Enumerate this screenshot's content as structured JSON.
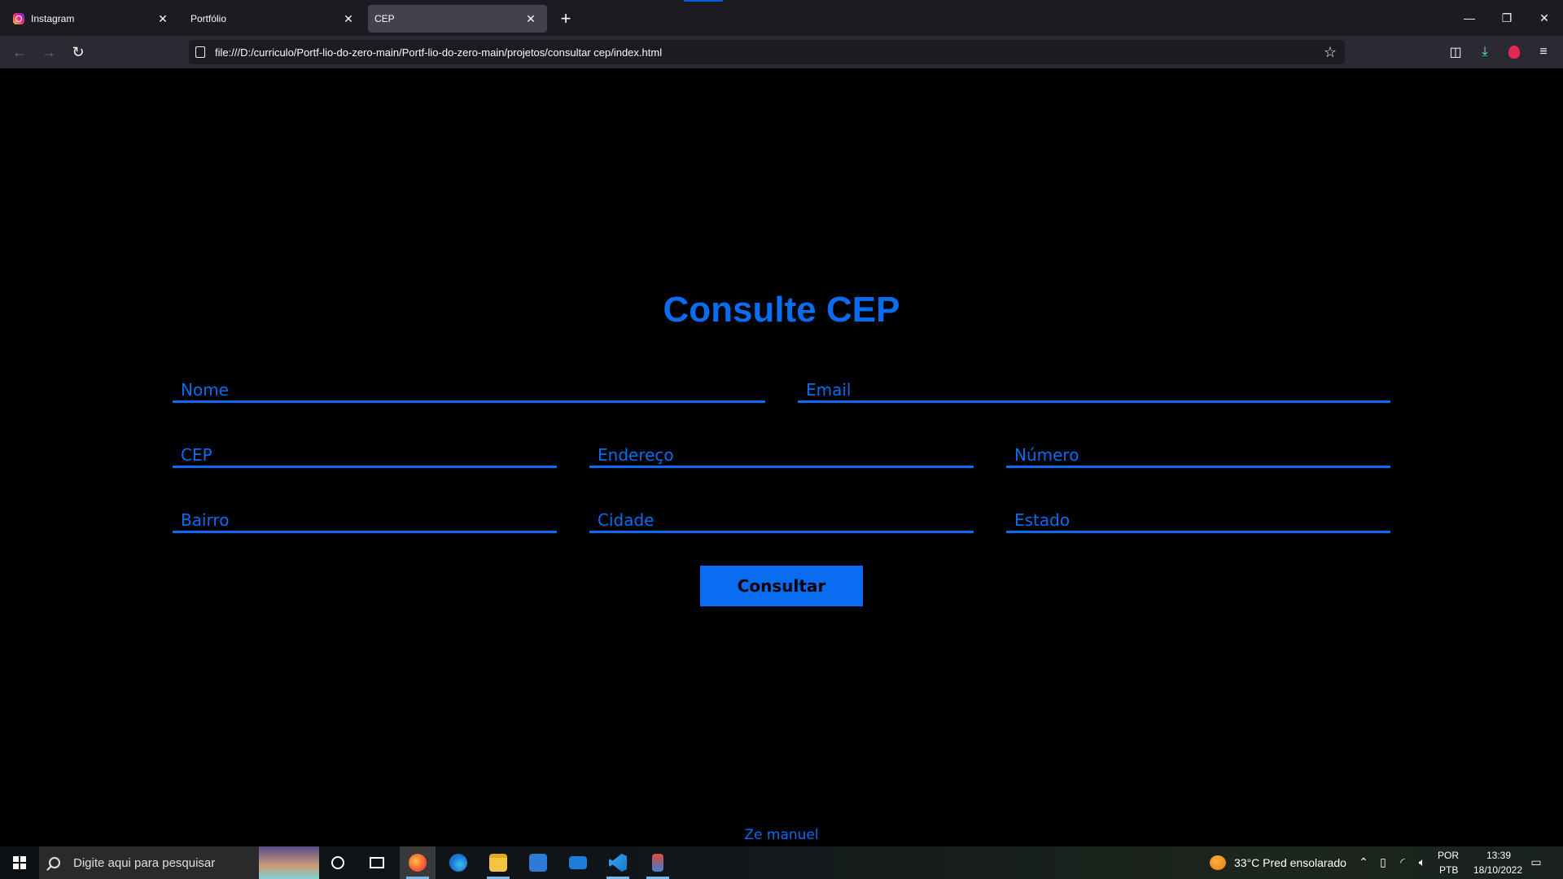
{
  "browser": {
    "tabs": [
      {
        "label": "Instagram",
        "active": false,
        "favicon": "instagram-icon"
      },
      {
        "label": "Portfólio",
        "active": false
      },
      {
        "label": "CEP",
        "active": true
      }
    ],
    "url": "file:///D:/curriculo/Portf-lio-do-zero-main/Portf-lio-do-zero-main/projetos/consultar cep/index.html",
    "accent_color": "#0060df"
  },
  "page": {
    "title": "Consulte CEP",
    "accent_color": "#0a6cf0",
    "fields": {
      "nome": "Nome",
      "email": "Email",
      "cep": "CEP",
      "endereco": "Endereço",
      "numero": "Número",
      "bairro": "Bairro",
      "cidade": "Cidade",
      "estado": "Estado"
    },
    "button_label": "Consultar",
    "footer": "Ze manuel"
  },
  "taskbar": {
    "search_placeholder": "Digite aqui para pesquisar",
    "weather": "33°C  Pred ensolarado",
    "language_top": "POR",
    "language_bottom": "PTB",
    "time": "13:39",
    "date": "18/10/2022"
  }
}
